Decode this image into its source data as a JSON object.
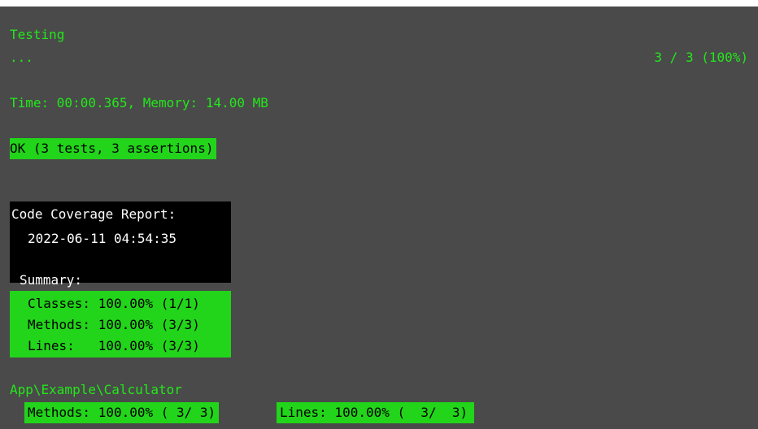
{
  "colors": {
    "terminal_background": "#4a4a4a",
    "success_green": "#22e81a",
    "success_bg": "#22d41a",
    "report_bg": "#000000",
    "report_text": "#ffffff"
  },
  "run": {
    "heading": "Testing",
    "progress_dots": "...",
    "progress_count": "3 / 3 (100%)",
    "stats": "Time: 00:00.365, Memory: 14.00 MB",
    "result": "OK (3 tests, 3 assertions)"
  },
  "coverage": {
    "title": "Code Coverage Report:",
    "timestamp": "2022-06-11 04:54:35",
    "summary_label": "Summary:",
    "classes": "Classes: 100.00% (1/1)",
    "methods": "Methods: 100.00% (3/3)",
    "lines": "Lines:   100.00% (3/3)"
  },
  "class_report": {
    "name": "App\\Example\\Calculator",
    "methods": "Methods: 100.00% ( 3/ 3)",
    "lines": "Lines: 100.00% (  3/  3)"
  }
}
